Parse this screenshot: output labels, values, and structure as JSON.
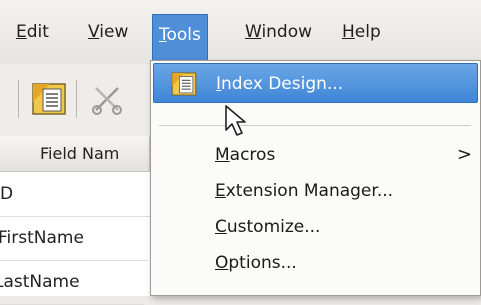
{
  "menubar": {
    "items": [
      {
        "mnemonic": "E",
        "rest": "dit"
      },
      {
        "mnemonic": "V",
        "rest": "iew"
      },
      {
        "mnemonic": "T",
        "rest": "ools"
      },
      {
        "mnemonic": "W",
        "rest": "indow"
      },
      {
        "mnemonic": "H",
        "rest": "elp"
      }
    ]
  },
  "table": {
    "header": "Field Nam",
    "rows": [
      "D",
      "FirstName",
      "LastName"
    ]
  },
  "tools_menu": {
    "items": [
      {
        "pre": "",
        "mnemonic": "I",
        "rest": "ndex Design..."
      },
      {
        "pre": "",
        "mnemonic": "M",
        "rest": "acros"
      },
      {
        "pre": "",
        "mnemonic": "E",
        "rest": "xtension Manager..."
      },
      {
        "pre": "",
        "mnemonic": "C",
        "rest": "ustomize..."
      },
      {
        "pre": "",
        "mnemonic": "O",
        "rest": "ptions..."
      }
    ],
    "submenu_arrow": ">"
  },
  "icons": {
    "toolbar": [
      "index-design-icon",
      "cut-icon"
    ],
    "menu": [
      "index-design-icon"
    ],
    "pointer": "mouse-pointer-icon"
  },
  "colors": {
    "accent": "#4f8fd8",
    "highlight": "#3f86d6"
  }
}
